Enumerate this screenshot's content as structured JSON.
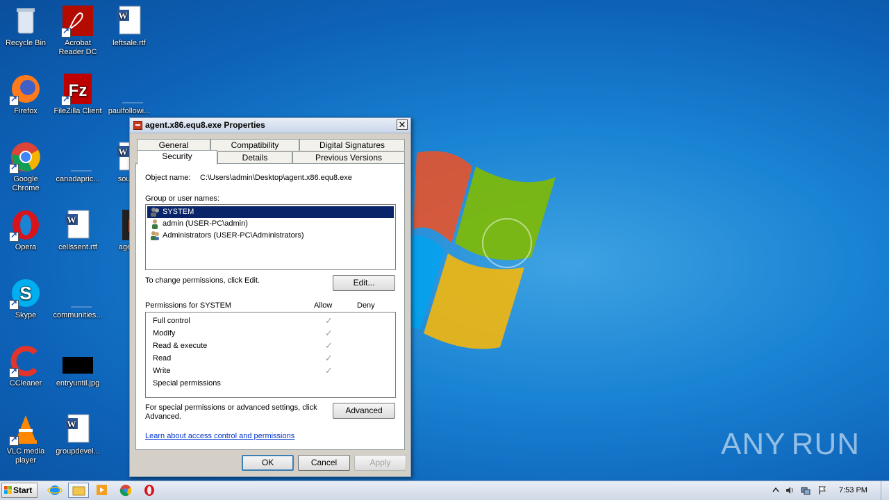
{
  "desktop_icons": [
    {
      "name": "recycle-bin",
      "label": "Recycle Bin"
    },
    {
      "name": "acrobat-reader",
      "label": "Acrobat Reader DC"
    },
    {
      "name": "leftsale-rtf",
      "label": "leftsale.rtf"
    },
    {
      "name": "firefox",
      "label": "Firefox"
    },
    {
      "name": "filezilla",
      "label": "FileZilla Client"
    },
    {
      "name": "paulfollowi",
      "label": "paulfollowi..."
    },
    {
      "name": "google-chrome",
      "label": "Google Chrome"
    },
    {
      "name": "canadapric",
      "label": "canadapric..."
    },
    {
      "name": "souths",
      "label": "souths"
    },
    {
      "name": "opera",
      "label": "Opera"
    },
    {
      "name": "cellssent-rtf",
      "label": "cellssent.rtf"
    },
    {
      "name": "agent",
      "label": "agent."
    },
    {
      "name": "skype",
      "label": "Skype"
    },
    {
      "name": "communities",
      "label": "communities..."
    },
    {
      "name": "ccleaner",
      "label": "CCleaner"
    },
    {
      "name": "entryuntil-jpg",
      "label": "entryuntil.jpg"
    },
    {
      "name": "vlc",
      "label": "VLC media player"
    },
    {
      "name": "groupdevel",
      "label": "groupdevel..."
    }
  ],
  "dialog": {
    "title": "agent.x86.equ8.exe Properties",
    "close_glyph": "✕",
    "tabs_row1": [
      "General",
      "Compatibility",
      "Digital Signatures"
    ],
    "tabs_row2": [
      "Security",
      "Details",
      "Previous Versions"
    ],
    "active_tab": "Security",
    "object_name_label": "Object name:",
    "object_name_value": "C:\\Users\\admin\\Desktop\\agent.x86.equ8.exe",
    "group_label": "Group or user names:",
    "users": [
      {
        "label": "SYSTEM",
        "selected": true
      },
      {
        "label": "admin (USER-PC\\admin)",
        "selected": false
      },
      {
        "label": "Administrators (USER-PC\\Administrators)",
        "selected": false
      }
    ],
    "change_perm_text": "To change permissions, click Edit.",
    "edit_button": "Edit...",
    "permissions_for": "Permissions for SYSTEM",
    "allow_header": "Allow",
    "deny_header": "Deny",
    "permissions": [
      {
        "label": "Full control",
        "allow": true,
        "deny": false
      },
      {
        "label": "Modify",
        "allow": true,
        "deny": false
      },
      {
        "label": "Read & execute",
        "allow": true,
        "deny": false
      },
      {
        "label": "Read",
        "allow": true,
        "deny": false
      },
      {
        "label": "Write",
        "allow": true,
        "deny": false
      },
      {
        "label": "Special permissions",
        "allow": false,
        "deny": false
      }
    ],
    "check_glyph": "✓",
    "special_text": "For special permissions or advanced settings, click Advanced.",
    "advanced_button": "Advanced",
    "learn_link": "Learn about access control and permissions",
    "ok_button": "OK",
    "cancel_button": "Cancel",
    "apply_button": "Apply"
  },
  "taskbar": {
    "start_label": "Start",
    "clock": "7:53 PM",
    "pinned": [
      "internet-explorer",
      "file-explorer",
      "media-player",
      "chrome",
      "opera"
    ]
  },
  "watermark": {
    "text_left": "ANY",
    "text_right": "RUN"
  }
}
